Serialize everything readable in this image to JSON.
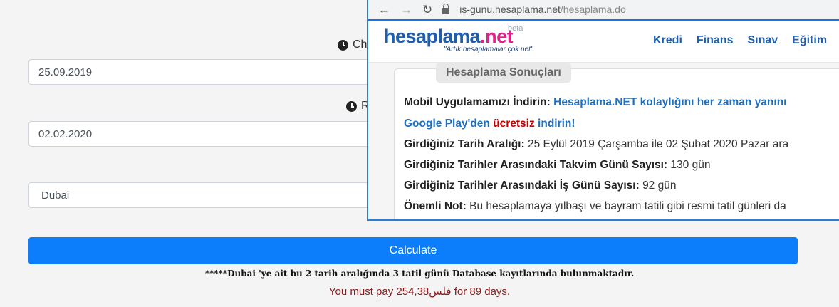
{
  "form": {
    "start_label": "Che",
    "start_value": "25.09.2019",
    "end_label": "R",
    "end_value": "02.02.2020",
    "city_value": "Dubai",
    "calculate_label": "Calculate",
    "db_note": "*****Dubai 'ye ait bu 2 tarih aralığında 3 tatil günü Database kayıtlarında bulunmaktadır.",
    "pay_line": "You must pay 254,38فلس for 89 days."
  },
  "browser": {
    "url_host": "is-gunu.hesaplama.net",
    "url_path": "/hesaplama.do",
    "icons": [
      "back-arrow-icon",
      "forward-arrow-icon",
      "reload-icon",
      "lock-icon"
    ]
  },
  "site": {
    "logo_main": "hesaplama",
    "logo_net": ".net",
    "beta": "beta",
    "tagline": "\"Artık hesaplamalar çok net\"",
    "menu": [
      "Kredi",
      "Finans",
      "Sınav",
      "Eğitim"
    ]
  },
  "results": {
    "legend": "Hesaplama Sonuçları",
    "app_label": "Mobil Uygulamamızı İndirin:",
    "app_text": "Hesaplama.NET kolaylığını her zaman yanını",
    "gp_pre": "Google Play'den",
    "gp_free": "ücretsiz",
    "gp_post": "indirin!",
    "range_label": "Girdiğiniz Tarih Aralığı:",
    "range_value": "25 Eylül 2019 Çarşamba ile 02 Şubat 2020 Pazar ara",
    "calendar_label": "Girdiğiniz Tarihler Arasındaki Takvim Günü Sayısı:",
    "calendar_value": "130 gün",
    "workday_label": "Girdiğiniz Tarihler Arasındaki İş Günü Sayısı:",
    "workday_value": "92 gün",
    "note_label": "Önemli Not:",
    "note_value": "Bu hesaplamaya yılbaşı ve bayram tatili gibi resmi tatil günleri da"
  }
}
